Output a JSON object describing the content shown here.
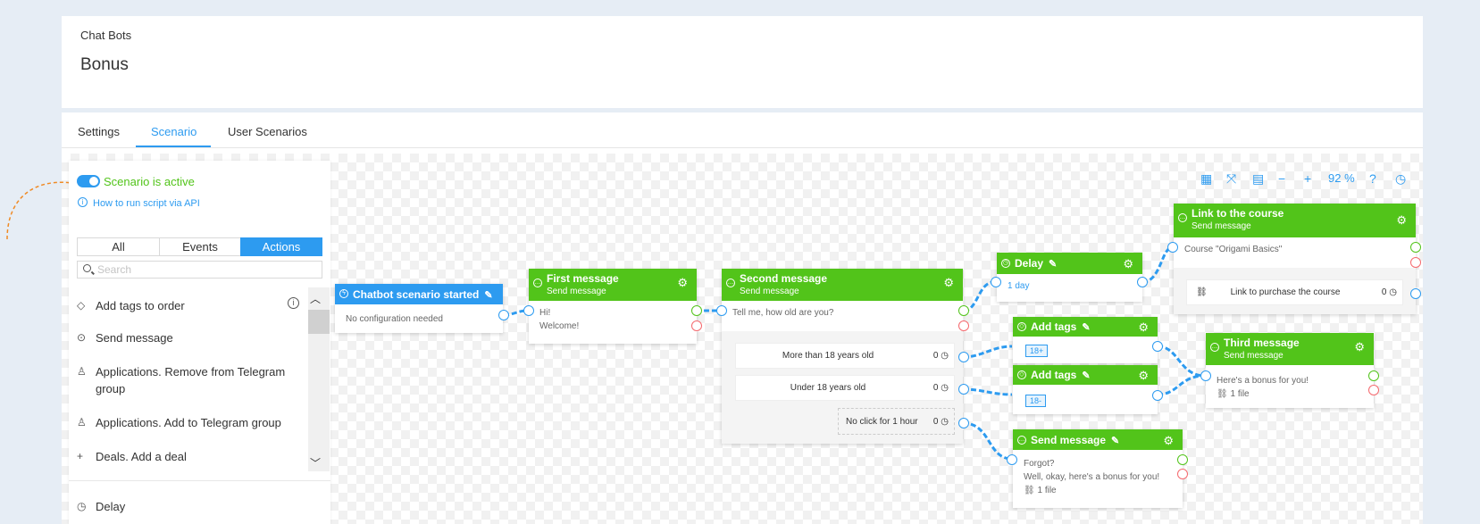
{
  "header": {
    "breadcrumb": "Chat Bots",
    "title": "Bonus"
  },
  "tabs": [
    {
      "label": "Settings"
    },
    {
      "label": "Scenario"
    },
    {
      "label": "User Scenarios"
    }
  ],
  "sidebar": {
    "status": "Scenario is active",
    "api_link": "How to run script via API",
    "filters": [
      {
        "label": "All"
      },
      {
        "label": "Events"
      },
      {
        "label": "Actions"
      }
    ],
    "search_placeholder": "Search",
    "items": [
      {
        "label": "Add tags to order",
        "icon": "tag-icon"
      },
      {
        "label": "Send message",
        "icon": "message-icon"
      },
      {
        "label": "Applications. Remove from Telegram group",
        "icon": "user-icon"
      },
      {
        "label": "Applications. Add to Telegram group",
        "icon": "user-icon"
      },
      {
        "label": "Deals. Add a deal",
        "icon": "plus-icon"
      },
      {
        "label": "Delay",
        "icon": "clock-icon"
      }
    ]
  },
  "toolbar": {
    "zoom": "92 %"
  },
  "nodes": {
    "start": {
      "title": "Chatbot scenario started",
      "body": "No configuration needed"
    },
    "first": {
      "title": "First message",
      "subtitle": "Send message",
      "body1": "Hi!",
      "body2": "Welcome!"
    },
    "second": {
      "title": "Second message",
      "subtitle": "Send message",
      "body": "Tell me, how old are you?",
      "buttons": [
        {
          "label": "More than 18 years old",
          "count": "0"
        },
        {
          "label": "Under 18 years old",
          "count": "0"
        },
        {
          "label": "No click for 1 hour",
          "count": "0"
        }
      ]
    },
    "delay": {
      "title": "Delay",
      "body": "1 day"
    },
    "link": {
      "title": "Link to the course",
      "subtitle": "Send message",
      "body": "Course \"Origami Basics\"",
      "button": {
        "label": "Link to purchase the course",
        "count": "0"
      }
    },
    "tags1": {
      "title": "Add tags",
      "tag": "18+"
    },
    "tags2": {
      "title": "Add tags",
      "tag": "18-"
    },
    "third": {
      "title": "Third message",
      "subtitle": "Send message",
      "body": "Here's a bonus for you!",
      "file": "1 file"
    },
    "send": {
      "title": "Send message",
      "body1": "Forgot?",
      "body2": "Well, okay, here's a bonus for you!",
      "file": "1 file"
    }
  },
  "colors": {
    "accent": "#2d9bf0",
    "green": "#52c41a",
    "red": "#f5696e",
    "connector_orange": "#f08a24"
  }
}
